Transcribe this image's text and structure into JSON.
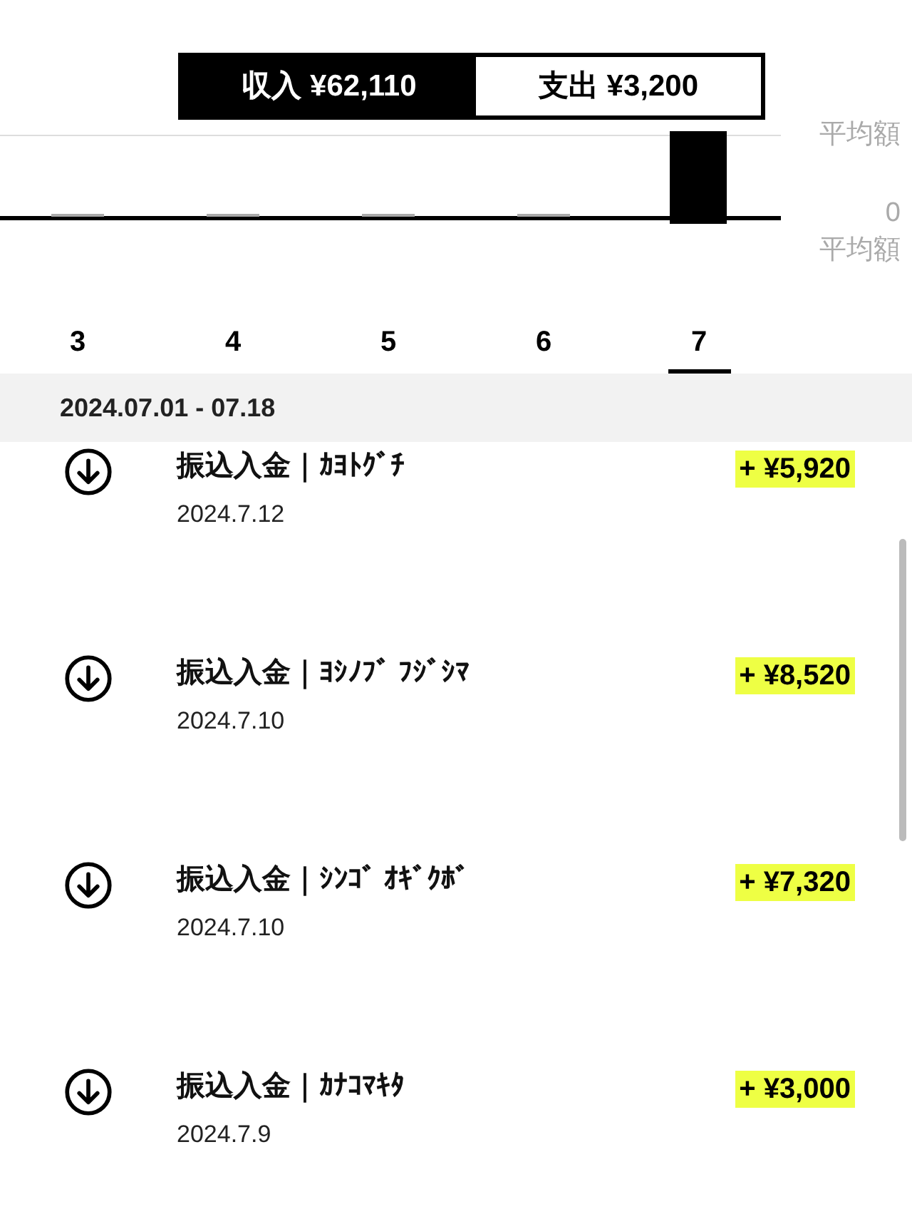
{
  "summary": {
    "income": "収入 ¥62,110",
    "expense": "支出 ¥3,200"
  },
  "chart_axis": {
    "average_top": "平均額",
    "zero": "0",
    "average_bottom": "平均額"
  },
  "months": [
    {
      "label": "3",
      "selected": false
    },
    {
      "label": "4",
      "selected": false
    },
    {
      "label": "5",
      "selected": false
    },
    {
      "label": "6",
      "selected": false
    },
    {
      "label": "7",
      "selected": true
    }
  ],
  "period": "2024.07.01 - 07.18",
  "transactions": [
    {
      "title": "振込入金｜ｶﾖﾄｸﾞﾁ",
      "date": "2024.7.12",
      "amount": "+ ¥5,920"
    },
    {
      "title": "振込入金｜ﾖｼﾉﾌﾞ ﾌｼﾞｼﾏ",
      "date": "2024.7.10",
      "amount": "+ ¥8,520"
    },
    {
      "title": "振込入金｜ｼﾝｺﾞ ｵｷﾞｸﾎﾞ",
      "date": "2024.7.10",
      "amount": "+ ¥7,320"
    },
    {
      "title": "振込入金｜ｶﾅｺﾏｷﾀ",
      "date": "2024.7.9",
      "amount": "+ ¥3,000"
    }
  ]
}
